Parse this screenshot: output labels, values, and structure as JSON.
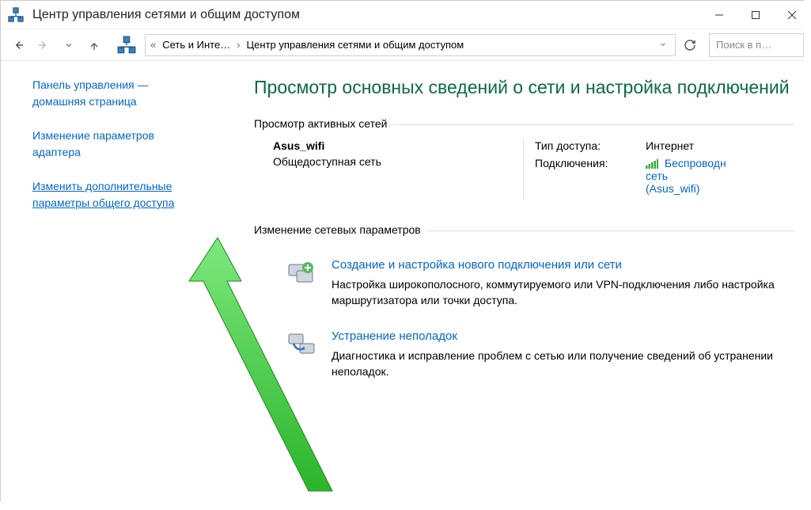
{
  "titlebar": {
    "title": "Центр управления сетями и общим доступом"
  },
  "addressbar": {
    "crumb1": "Сеть и Инте…",
    "crumb2": "Центр управления сетями и общим доступом",
    "search_placeholder": "Поиск в п…"
  },
  "sidebar": {
    "home1": "Панель управления —",
    "home2": "домашняя страница",
    "adapter1": "Изменение параметров",
    "adapter2": "адаптера",
    "sharing1": "Изменить дополнительные",
    "sharing2": "параметры общего доступа"
  },
  "main": {
    "heading": "Просмотр основных сведений о сети и настройка подключений",
    "active_title": "Просмотр активных сетей",
    "network": {
      "name": "Asus_wifi",
      "type": "Общедоступная сеть",
      "access_label": "Тип доступа:",
      "access_value": "Интернет",
      "conn_label": "Подключения:",
      "conn_value1": "Беспроводн",
      "conn_value2": "сеть",
      "conn_value3": "(Asus_wifi)"
    },
    "change_title": "Изменение сетевых параметров",
    "tasks": [
      {
        "title": "Создание и настройка нового подключения или сети",
        "desc": "Настройка широкополосного, коммутируемого или VPN-подключения либо настройка маршрутизатора или точки доступа."
      },
      {
        "title": "Устранение неполадок",
        "desc": "Диагностика и исправление проблем с сетью или получение сведений об устранении неполадок."
      }
    ]
  }
}
